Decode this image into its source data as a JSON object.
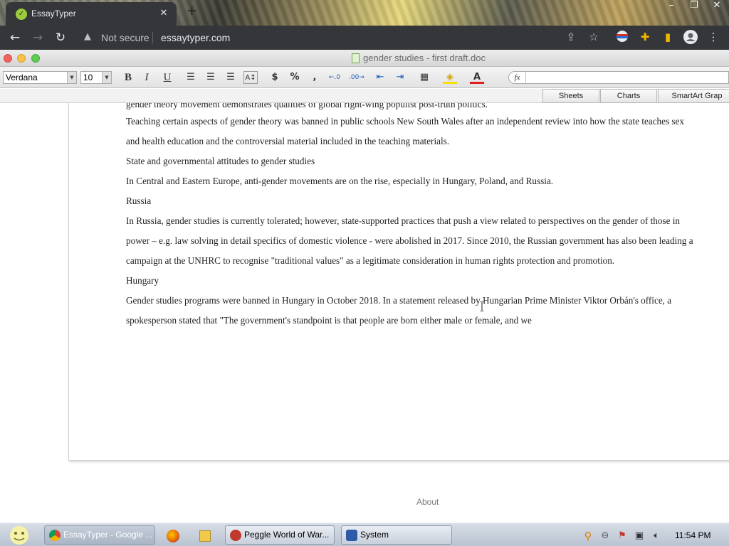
{
  "browser": {
    "tab_title": "EssayTyper",
    "new_tab": "+",
    "not_secure": "Not secure",
    "url": "essaytyper.com"
  },
  "doc_window": {
    "title": "gender studies - first draft.doc"
  },
  "toolbar": {
    "font": "Verdana",
    "size": "10",
    "bold": "B",
    "italic": "I",
    "underline": "U",
    "currency": "$",
    "percent": "%",
    "comma": ",",
    "fx": "fx"
  },
  "ribbon_tabs": [
    "Sheets",
    "Charts",
    "SmartArt Grap"
  ],
  "document": {
    "cutoff_line": "gender theory movement demonstrates qualities of global right-wing populist post-truth politics.",
    "paragraphs": [
      "Teaching certain aspects of gender theory was banned in public schools New South Wales after an independent review into how the state teaches sex",
      "and health education and the controversial material included in the teaching materials.",
      "State and governmental attitudes to gender studies",
      "In Central and Eastern Europe, anti-gender movements are on the rise, especially in Hungary, Poland, and Russia.",
      "Russia",
      "In Russia, gender studies is currently tolerated; however, state-supported practices that push a view related to perspectives on the gender of those in",
      "power – e.g. law solving in detail specifics of domestic violence - were abolished in 2017. Since 2010, the Russian government has also been leading a",
      "campaign at the UNHRC to recognise \"traditional values\" as a legitimate consideration in human rights protection and promotion.",
      "Hungary",
      "Gender studies programs were banned in Hungary in October 2018. In a statement released by Hungarian Prime Minister Viktor Orbán's office, a",
      "spokesperson stated that \"The government's standpoint is that people are born either male or female, and we"
    ]
  },
  "footer": {
    "about": "About"
  },
  "taskbar": {
    "tasks": [
      "EssayTyper - Google ...",
      "Peggle World of War...",
      "System"
    ],
    "clock": "11:54 PM"
  },
  "colors": {
    "chrome_dark": "#35363a",
    "window_title_text": "#6b6b6b",
    "doc_text": "#222222",
    "taskbar": "#c8d0dc"
  }
}
